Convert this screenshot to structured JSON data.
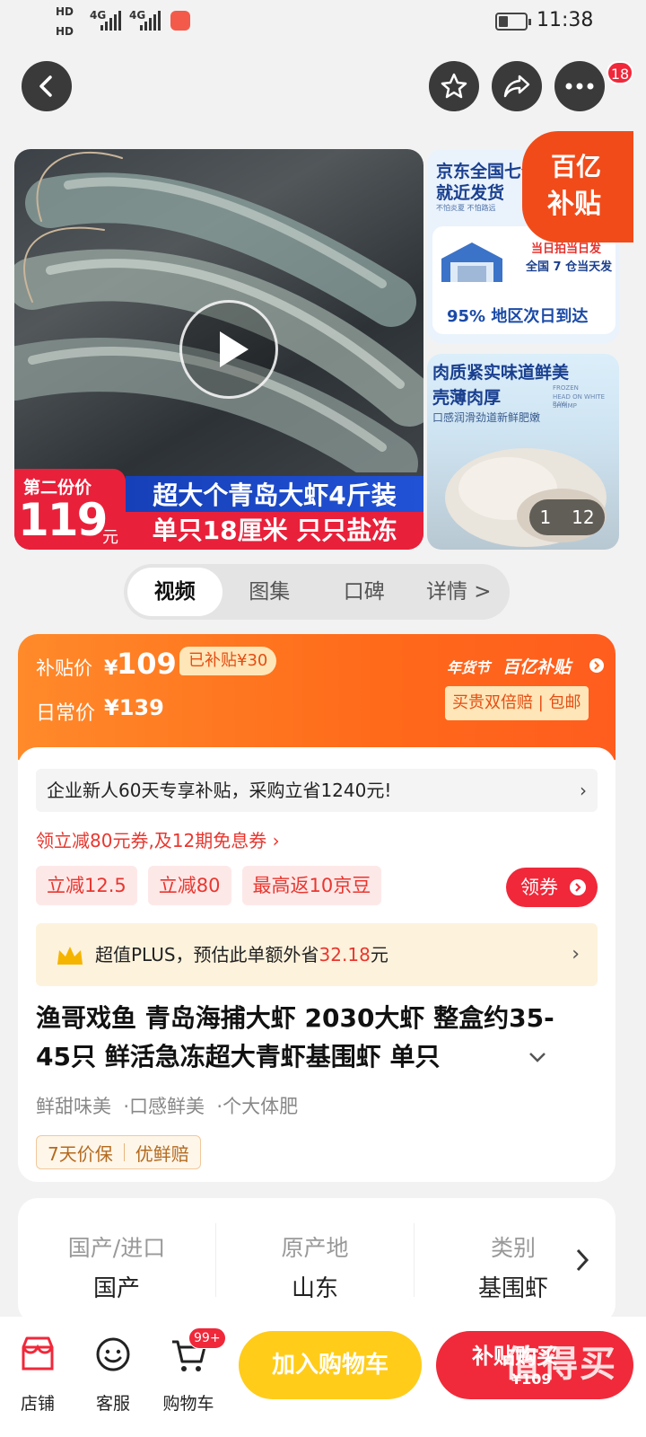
{
  "status_bar": {
    "hd1": "HD",
    "hd2": "HD",
    "net1": "4G",
    "net2": "4G",
    "time": "11:38"
  },
  "top_nav": {
    "cart_badge": "18"
  },
  "gallery": {
    "price_label": "第二份价",
    "price_value": "119",
    "price_unit": "元",
    "banner_line1": "超大个青岛大虾4斤装",
    "banner_line2": "单只18厘米 只只盐冻",
    "thumb1_title_line1": "京东全国七仓",
    "thumb1_title_line2": "就近发货",
    "thumb1_small": "不怕炎夏  不怕路远",
    "thumb1_red1": "当日拍当日发",
    "thumb1_red2": "全国 7 仓当天发",
    "thumb1_blue": "95% 地区次日到达",
    "thumb2_title1": "肉质紧实味道鲜美",
    "thumb2_title2": "壳薄肉厚",
    "thumb2_sub": "口感润滑劲道新鲜肥嫩",
    "thumb2_small1": "FROZEN",
    "thumb2_small2": "HEAD ON WHITE RAW",
    "thumb2_small3": "SHRIMP",
    "subsidy_top": "百亿",
    "subsidy_bottom": "补贴",
    "pager_current": "1",
    "pager_total": "12"
  },
  "tabs": [
    "视频",
    "图集",
    "口碑",
    "详情 >"
  ],
  "price_card": {
    "subsidy_label": "补贴价",
    "subsidy_currency": "¥",
    "subsidy_price": "109",
    "already_subsidy": "已补贴¥30",
    "daily_label": "日常价",
    "daily_price": "¥139",
    "festival": "年货节",
    "brand": "百亿补贴",
    "guarantee": "买贵双倍赔 | 包邮",
    "enterprise_text": "企业新人60天专享补贴，采购立省1240元!",
    "coupon_link": "领立减80元券,及12期免息券 ›",
    "chips": [
      "立减12.5",
      "立减80",
      "最高返10京豆"
    ],
    "get_coupon": "领券",
    "plus_text_pre": "超值PLUS，预估此单额外省",
    "plus_amount": "32.18",
    "plus_text_post": "元",
    "title": "渔哥戏鱼 青岛海捕大虾 2030大虾 整盒约35-45只 鲜活急冻超大青虾基围虾 单只",
    "features": [
      "鲜甜味美",
      "·口感鲜美",
      "·个大体肥"
    ],
    "service1": "7天价保",
    "service2": "优鲜赔"
  },
  "attributes": [
    {
      "key": "国产/进口",
      "value": "国产"
    },
    {
      "key": "原产地",
      "value": "山东"
    },
    {
      "key": "类别",
      "value": "基围虾"
    }
  ],
  "bottom_bar": {
    "store": "店铺",
    "service": "客服",
    "cart": "购物车",
    "cart_badge": "99+",
    "add_to_cart": "加入购物车",
    "buy_label": "补贴购买",
    "buy_price": "¥109",
    "watermark": "值得买",
    "watermark_url": "zhizhizhi.com"
  },
  "colors": {
    "accent_orange": "#ff6a1a",
    "accent_red": "#f02a3a",
    "yellow": "#ffcc1a"
  }
}
